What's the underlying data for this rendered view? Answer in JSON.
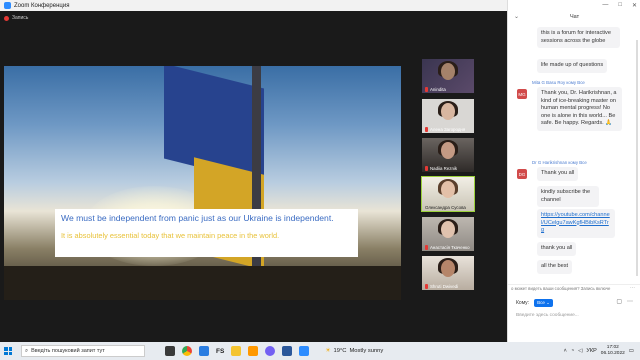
{
  "titlebar": {
    "app_title": "Zoom Конференция"
  },
  "recording": {
    "label": "Запись"
  },
  "share": {
    "caption_line1": "We must be independent from panic just as our Ukraine is independent.",
    "caption_line2": "It is absolutely essential today that we maintain peace in the world."
  },
  "participants": [
    {
      "name": "Anindita"
    },
    {
      "name": "Алена Загородня"
    },
    {
      "name": "Nadiia Reznik"
    },
    {
      "name": "Олександра Сусова"
    },
    {
      "name": "Анастасія Ткаченко"
    },
    {
      "name": "Shruti Dwivedi"
    }
  ],
  "chat": {
    "title": "Чат",
    "window_buttons": [
      "—",
      "□",
      "✕"
    ],
    "messages": {
      "m1": "this is a forum for interactive sessions across the globe",
      "m2": "life made up of questions",
      "sender1": "Mita G Basu Roy кому Все",
      "avatar1": "MG",
      "m3": "Thank you, Dr. Harikrishnan, a kind of ice-breaking master on human mental progress! No one is alone in this world... Be safe. Be happy. Regards. 🙏",
      "sender2": "Dr G Harikrishnan кому Все",
      "avatar2": "DG",
      "m4": "Thank you all",
      "m5": "kindly subscribe the channel",
      "m6": "https://youtube.com/channel/UCelgu7awKgfHBibKsRTrg",
      "m7": "thank  you all",
      "m8": "all the best"
    },
    "notice": "о может видеть ваши сообщения? Запись включе",
    "to_label": "Кому:",
    "to_value": "Все",
    "input_placeholder": "Введите здесь сообщение..."
  },
  "taskbar": {
    "search_placeholder": "Введіть пошуковий запит тут",
    "weather_temp": "19°C",
    "weather_text": "Mostly sunny",
    "lang": "УКР",
    "time": "17:02",
    "date": "06.10.2022"
  },
  "colors": {
    "chat_link": "#1f6fce",
    "active_speaker": "#9bd13b",
    "taskbar": "#e7ebf0"
  }
}
